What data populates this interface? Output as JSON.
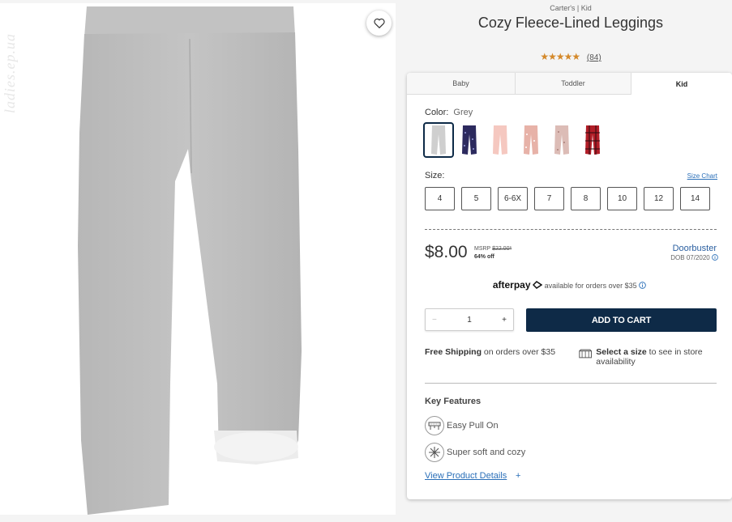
{
  "product": {
    "brand_line": "Carter's | Kid",
    "title": "Cozy Fleece-Lined Leggings",
    "rating_stars": "★★★★★",
    "review_count": "(84)",
    "watermark": "ladies.ep.ua"
  },
  "tabs": [
    {
      "label": "Baby",
      "selected": false
    },
    {
      "label": "Toddler",
      "selected": false
    },
    {
      "label": "Kid",
      "selected": true
    }
  ],
  "color": {
    "label": "Color:",
    "value": "Grey",
    "swatches": [
      {
        "name": "Grey",
        "hex": "#d0d0d0",
        "selected": true
      },
      {
        "name": "Navy Print",
        "hex": "#2c2a5e"
      },
      {
        "name": "Light Pink",
        "hex": "#f5c8c0"
      },
      {
        "name": "Pink Print",
        "hex": "#e7b2a8"
      },
      {
        "name": "Blush Print",
        "hex": "#dcbcb6"
      },
      {
        "name": "Red Plaid",
        "hex": "#b11d27"
      }
    ]
  },
  "size": {
    "label": "Size:",
    "chart_link": "Size Chart",
    "options": [
      "4",
      "5",
      "6-6X",
      "7",
      "8",
      "10",
      "12",
      "14"
    ]
  },
  "pricing": {
    "price": "$8.00",
    "msrp_label": "MSRP",
    "msrp_value": "$22.00*",
    "discount": "64% off",
    "promo": "Doorbuster",
    "promo_note": "DOB 07/2020"
  },
  "afterpay": {
    "logo": "afterpay",
    "text": "available for orders over $35"
  },
  "cart": {
    "minus": "−",
    "quantity": "1",
    "plus": "+",
    "add_label": "ADD TO CART"
  },
  "shipping": {
    "bold": "Free Shipping",
    "rest": " on orders over $35",
    "store_bold": "Select a size",
    "store_rest": " to see in store availability"
  },
  "features": {
    "title": "Key Features",
    "items": [
      "Easy Pull On",
      "Super soft and cozy"
    ],
    "details_link": "View Product Details",
    "details_plus": "+"
  },
  "colors": {
    "accent_navy": "#0e2a47",
    "link_blue": "#2a6fb8",
    "star_orange": "#d4892a"
  }
}
